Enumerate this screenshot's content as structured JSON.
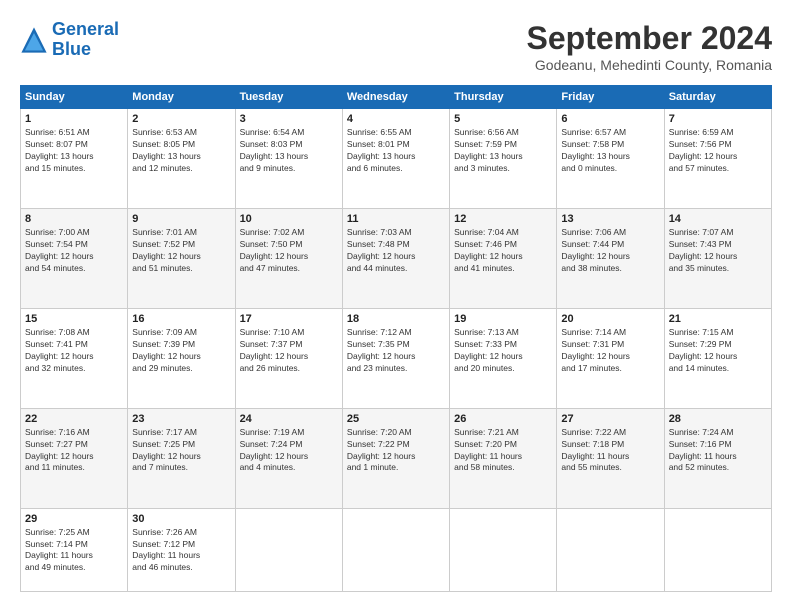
{
  "logo": {
    "line1": "General",
    "line2": "Blue"
  },
  "title": "September 2024",
  "subtitle": "Godeanu, Mehedinti County, Romania",
  "days": [
    "Sunday",
    "Monday",
    "Tuesday",
    "Wednesday",
    "Thursday",
    "Friday",
    "Saturday"
  ],
  "weeks": [
    [
      {
        "num": "1",
        "info": "Sunrise: 6:51 AM\nSunset: 8:07 PM\nDaylight: 13 hours\nand 15 minutes."
      },
      {
        "num": "2",
        "info": "Sunrise: 6:53 AM\nSunset: 8:05 PM\nDaylight: 13 hours\nand 12 minutes."
      },
      {
        "num": "3",
        "info": "Sunrise: 6:54 AM\nSunset: 8:03 PM\nDaylight: 13 hours\nand 9 minutes."
      },
      {
        "num": "4",
        "info": "Sunrise: 6:55 AM\nSunset: 8:01 PM\nDaylight: 13 hours\nand 6 minutes."
      },
      {
        "num": "5",
        "info": "Sunrise: 6:56 AM\nSunset: 7:59 PM\nDaylight: 13 hours\nand 3 minutes."
      },
      {
        "num": "6",
        "info": "Sunrise: 6:57 AM\nSunset: 7:58 PM\nDaylight: 13 hours\nand 0 minutes."
      },
      {
        "num": "7",
        "info": "Sunrise: 6:59 AM\nSunset: 7:56 PM\nDaylight: 12 hours\nand 57 minutes."
      }
    ],
    [
      {
        "num": "8",
        "info": "Sunrise: 7:00 AM\nSunset: 7:54 PM\nDaylight: 12 hours\nand 54 minutes."
      },
      {
        "num": "9",
        "info": "Sunrise: 7:01 AM\nSunset: 7:52 PM\nDaylight: 12 hours\nand 51 minutes."
      },
      {
        "num": "10",
        "info": "Sunrise: 7:02 AM\nSunset: 7:50 PM\nDaylight: 12 hours\nand 47 minutes."
      },
      {
        "num": "11",
        "info": "Sunrise: 7:03 AM\nSunset: 7:48 PM\nDaylight: 12 hours\nand 44 minutes."
      },
      {
        "num": "12",
        "info": "Sunrise: 7:04 AM\nSunset: 7:46 PM\nDaylight: 12 hours\nand 41 minutes."
      },
      {
        "num": "13",
        "info": "Sunrise: 7:06 AM\nSunset: 7:44 PM\nDaylight: 12 hours\nand 38 minutes."
      },
      {
        "num": "14",
        "info": "Sunrise: 7:07 AM\nSunset: 7:43 PM\nDaylight: 12 hours\nand 35 minutes."
      }
    ],
    [
      {
        "num": "15",
        "info": "Sunrise: 7:08 AM\nSunset: 7:41 PM\nDaylight: 12 hours\nand 32 minutes."
      },
      {
        "num": "16",
        "info": "Sunrise: 7:09 AM\nSunset: 7:39 PM\nDaylight: 12 hours\nand 29 minutes."
      },
      {
        "num": "17",
        "info": "Sunrise: 7:10 AM\nSunset: 7:37 PM\nDaylight: 12 hours\nand 26 minutes."
      },
      {
        "num": "18",
        "info": "Sunrise: 7:12 AM\nSunset: 7:35 PM\nDaylight: 12 hours\nand 23 minutes."
      },
      {
        "num": "19",
        "info": "Sunrise: 7:13 AM\nSunset: 7:33 PM\nDaylight: 12 hours\nand 20 minutes."
      },
      {
        "num": "20",
        "info": "Sunrise: 7:14 AM\nSunset: 7:31 PM\nDaylight: 12 hours\nand 17 minutes."
      },
      {
        "num": "21",
        "info": "Sunrise: 7:15 AM\nSunset: 7:29 PM\nDaylight: 12 hours\nand 14 minutes."
      }
    ],
    [
      {
        "num": "22",
        "info": "Sunrise: 7:16 AM\nSunset: 7:27 PM\nDaylight: 12 hours\nand 11 minutes."
      },
      {
        "num": "23",
        "info": "Sunrise: 7:17 AM\nSunset: 7:25 PM\nDaylight: 12 hours\nand 7 minutes."
      },
      {
        "num": "24",
        "info": "Sunrise: 7:19 AM\nSunset: 7:24 PM\nDaylight: 12 hours\nand 4 minutes."
      },
      {
        "num": "25",
        "info": "Sunrise: 7:20 AM\nSunset: 7:22 PM\nDaylight: 12 hours\nand 1 minute."
      },
      {
        "num": "26",
        "info": "Sunrise: 7:21 AM\nSunset: 7:20 PM\nDaylight: 11 hours\nand 58 minutes."
      },
      {
        "num": "27",
        "info": "Sunrise: 7:22 AM\nSunset: 7:18 PM\nDaylight: 11 hours\nand 55 minutes."
      },
      {
        "num": "28",
        "info": "Sunrise: 7:24 AM\nSunset: 7:16 PM\nDaylight: 11 hours\nand 52 minutes."
      }
    ],
    [
      {
        "num": "29",
        "info": "Sunrise: 7:25 AM\nSunset: 7:14 PM\nDaylight: 11 hours\nand 49 minutes."
      },
      {
        "num": "30",
        "info": "Sunrise: 7:26 AM\nSunset: 7:12 PM\nDaylight: 11 hours\nand 46 minutes."
      },
      {
        "num": "",
        "info": ""
      },
      {
        "num": "",
        "info": ""
      },
      {
        "num": "",
        "info": ""
      },
      {
        "num": "",
        "info": ""
      },
      {
        "num": "",
        "info": ""
      }
    ]
  ]
}
